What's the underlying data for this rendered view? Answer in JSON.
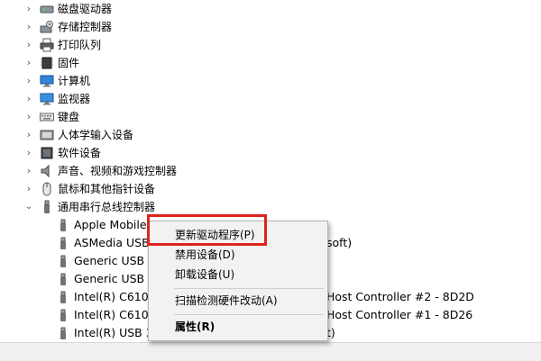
{
  "categories": [
    {
      "label": "磁盘驱动器",
      "icon": "disk-drive-icon"
    },
    {
      "label": "存储控制器",
      "icon": "storage-controller-icon"
    },
    {
      "label": "打印队列",
      "icon": "printer-icon"
    },
    {
      "label": "固件",
      "icon": "firmware-chip-icon"
    },
    {
      "label": "计算机",
      "icon": "computer-monitor-icon"
    },
    {
      "label": "监视器",
      "icon": "monitor-icon"
    },
    {
      "label": "键盘",
      "icon": "keyboard-icon"
    },
    {
      "label": "人体学输入设备",
      "icon": "hid-icon"
    },
    {
      "label": "软件设备",
      "icon": "software-device-icon"
    },
    {
      "label": "声音、视频和游戏控制器",
      "icon": "speaker-icon"
    },
    {
      "label": "鼠标和其他指针设备",
      "icon": "mouse-icon"
    },
    {
      "label": "通用串行总线控制器",
      "icon": "usb-icon"
    }
  ],
  "usb_children": [
    {
      "label": "Apple Mobile Device USB Driver",
      "visible": "Apple Mobile"
    },
    {
      "label": "ASMedia USB",
      "visible": "ASMedia USB",
      "trailing": "soft)"
    },
    {
      "label": "Generic USB",
      "visible": "Generic USB"
    },
    {
      "label": "Generic USB",
      "visible": "Generic USB"
    },
    {
      "label": "Intel(R) C610",
      "visible": "Intel(R) C610",
      "trailing": "Host Controller #2 - 8D2D"
    },
    {
      "label": "Intel(R) C610",
      "visible": "Intel(R) C610",
      "trailing": "Host Controller #1 - 8D26"
    },
    {
      "label": "Intel(R) USB 3",
      "visible": "Intel(R) USB 3",
      "trailing": "t)"
    }
  ],
  "context_menu": {
    "update_driver": "更新驱动程序(P)",
    "disable_device": "禁用设备(D)",
    "uninstall_device": "卸载设备(U)",
    "scan_hardware": "扫描检测硬件改动(A)",
    "properties": "属性(R)"
  },
  "colors": {
    "highlight": "#e0231c",
    "menu_bg": "#f2f2f2"
  }
}
